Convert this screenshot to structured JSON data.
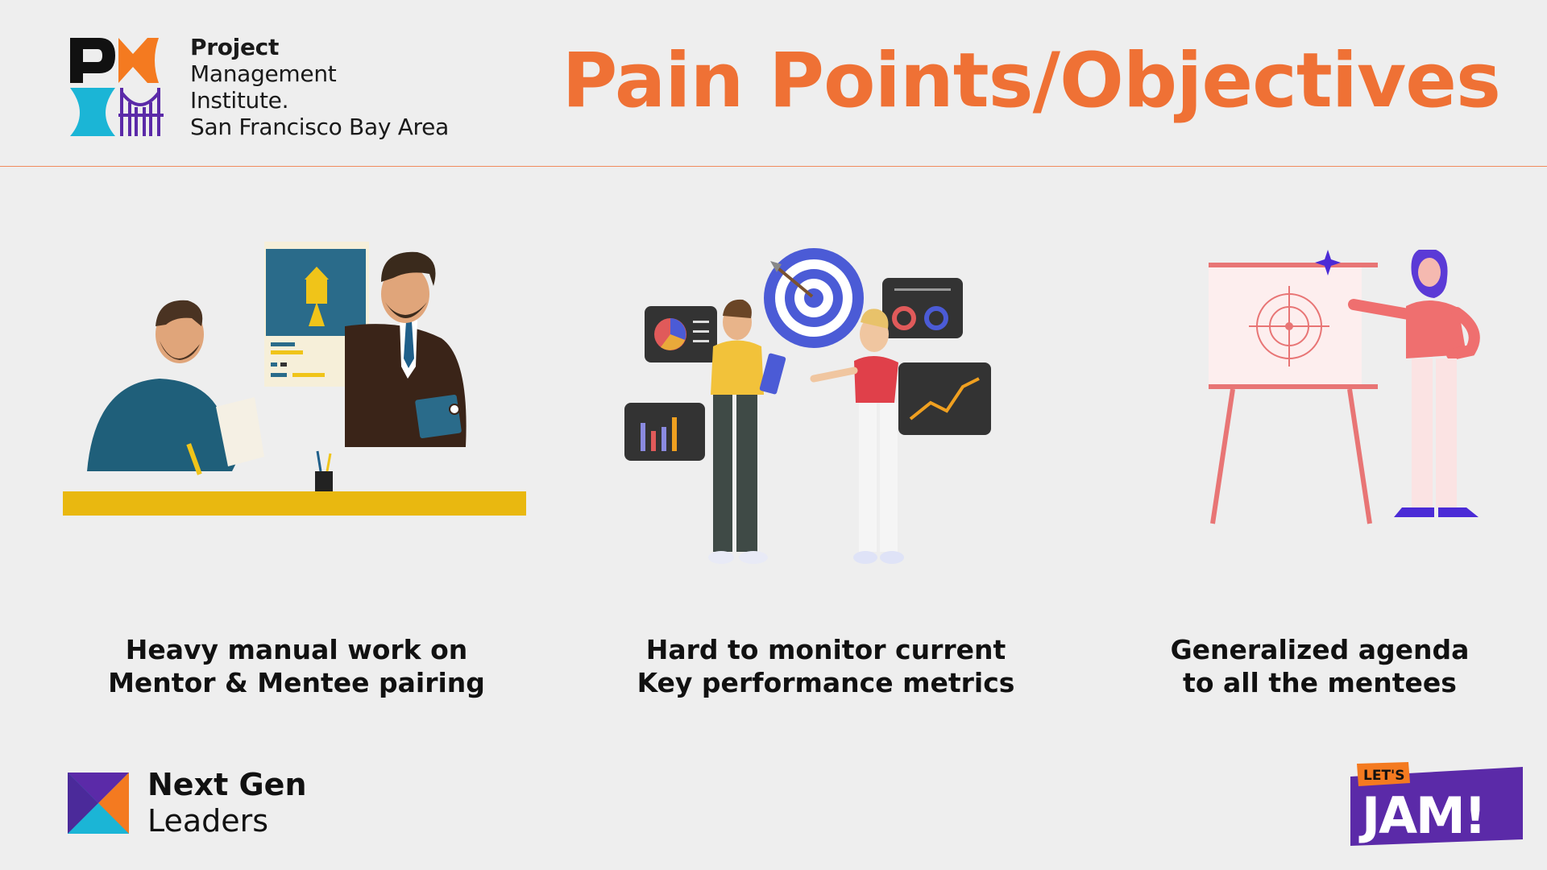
{
  "header": {
    "org_lines": [
      "Project",
      "Management",
      "Institute.",
      "San Francisco Bay Area"
    ],
    "title": "Pain Points/Objectives"
  },
  "pain_points": [
    {
      "line1": "Heavy manual work on",
      "line2": "Mentor & Mentee pairing"
    },
    {
      "line1": "Hard to monitor current",
      "line2": "Key performance metrics"
    },
    {
      "line1": "Generalized agenda",
      "line2": "to all the mentees"
    }
  ],
  "footer": {
    "brand_line1": "Next Gen",
    "brand_line2": "Leaders",
    "badge_top": "LET'S",
    "badge_main": "JAM!"
  },
  "colors": {
    "accent": "#ef7135",
    "teal": "#1bb5d6",
    "purple": "#5b2aa8",
    "orange": "#f47a20"
  }
}
